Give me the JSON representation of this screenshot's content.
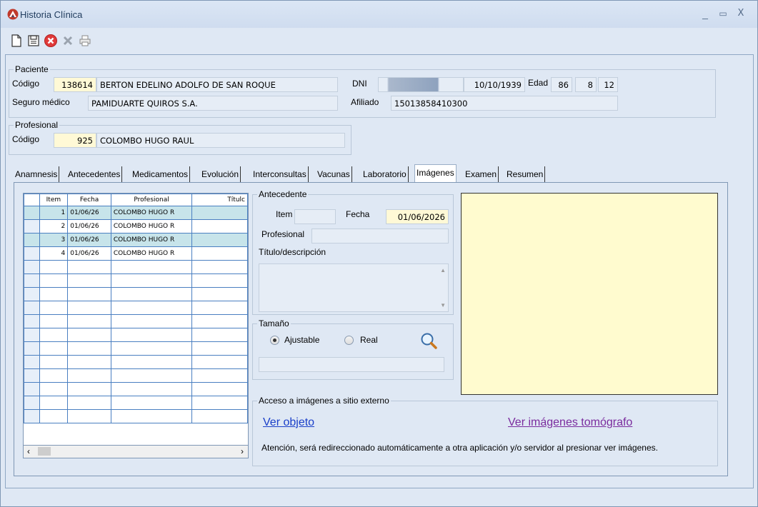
{
  "window": {
    "title": "Historia Clínica",
    "minimize": "_",
    "maximize": "▭",
    "close": "X"
  },
  "paciente": {
    "group_label": "Paciente",
    "codigo_label": "Código",
    "codigo": "138614",
    "nombre": "BERTON EDELINO ADOLFO DE SAN ROQUE",
    "dni_label": "DNI",
    "fecha_nac": "10/10/1939",
    "edad_label": "Edad",
    "edad_anios": "86",
    "edad_meses": "8",
    "edad_dias": "12",
    "seguro_label": "Seguro médico",
    "seguro": "PAMIDUARTE QUIROS S.A.",
    "afiliado_label": "Afiliado",
    "afiliado": "15013858410300"
  },
  "profesional": {
    "group_label": "Profesional",
    "codigo_label": "Código",
    "codigo": "925",
    "nombre": "COLOMBO HUGO RAUL"
  },
  "tabs": [
    "Anamnesis",
    "Antecedentes",
    "Medicamentos",
    "Evolución",
    "Interconsultas",
    "Vacunas",
    "Laboratorio",
    "Imágenes",
    "Examen",
    "Resumen"
  ],
  "active_tab": "Imágenes",
  "grid": {
    "headers": [
      "Item",
      "Fecha",
      "Profesional",
      "Títulc"
    ],
    "rows": [
      {
        "item": "1",
        "fecha": "01/06/26",
        "profesional": "COLOMBO HUGO R",
        "selected": true
      },
      {
        "item": "2",
        "fecha": "01/06/26",
        "profesional": "COLOMBO HUGO R",
        "selected": false
      },
      {
        "item": "3",
        "fecha": "01/06/26",
        "profesional": "COLOMBO HUGO R",
        "selected": true
      },
      {
        "item": "4",
        "fecha": "01/06/26",
        "profesional": "COLOMBO HUGO R",
        "selected": false
      }
    ]
  },
  "antecedente": {
    "group_label": "Antecedente",
    "item_label": "Item",
    "fecha_label": "Fecha",
    "fecha": "01/06/2026",
    "profesional_label": "Profesional",
    "titulo_label": "Título/descripción"
  },
  "tamano": {
    "group_label": "Tamaño",
    "ajustable": "Ajustable",
    "real": "Real",
    "selected": "Ajustable"
  },
  "acceso": {
    "group_label": "Acceso a imágenes a sitio externo",
    "ver_objeto": "Ver objeto",
    "ver_tomografo": "Ver imágenes tomógrafo",
    "aviso": "Atención, será redireccionado automáticamente a otra aplicación y/o servidor al presionar ver imágenes."
  },
  "colors": {
    "link": "#1a3fc9",
    "link_visited": "#7a2b9e",
    "selected_row": "#c7e4ea",
    "highlight_field": "#fff9d6",
    "image_bg": "#fffbcf"
  }
}
